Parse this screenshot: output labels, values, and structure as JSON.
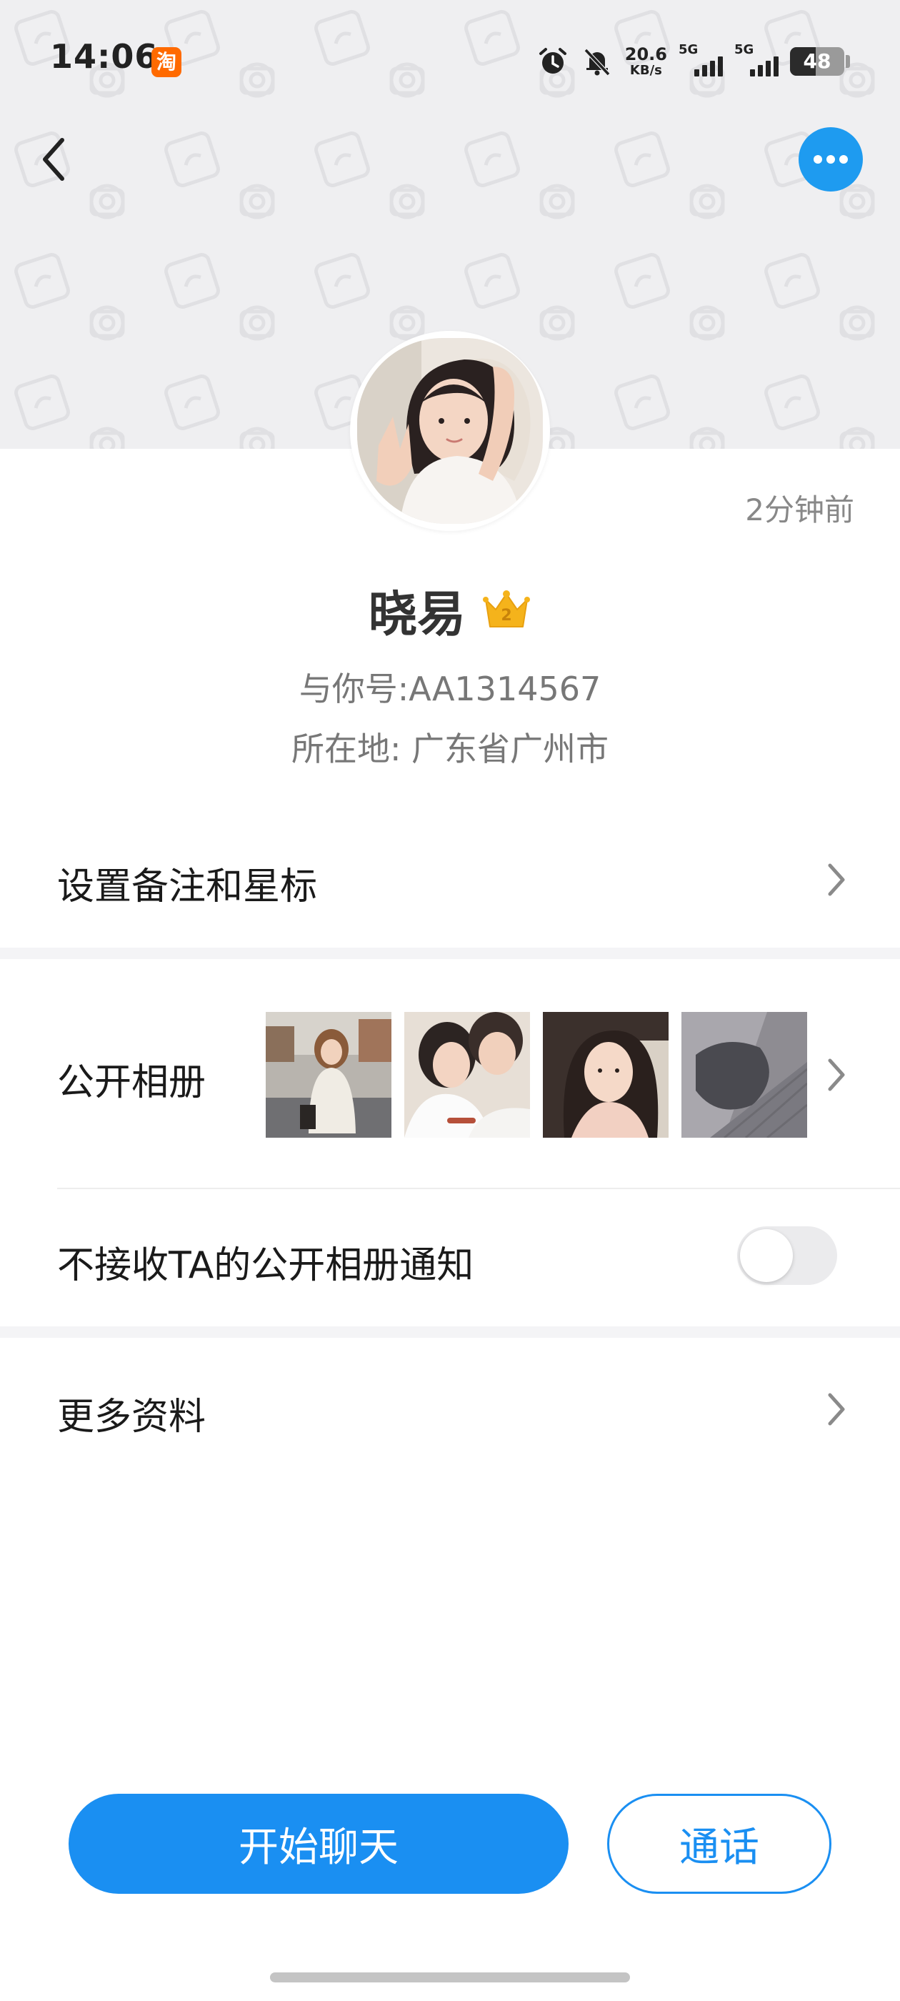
{
  "status_bar": {
    "time": "14:06",
    "app_badge": "淘",
    "net_speed_value": "20.6",
    "net_speed_unit": "KB/s",
    "sim1_label": "5G",
    "sim2_label": "5G",
    "battery_level": "48"
  },
  "nav": {
    "back_icon": "chevron-left-icon",
    "more_icon": "ellipsis-icon"
  },
  "profile": {
    "last_seen": "2分钟前",
    "name": "晓易",
    "vip_level": "2",
    "account_id": "与你号:AA1314567",
    "location": "所在地: 广东省广州市"
  },
  "rows": {
    "remark": "设置备注和星标",
    "album": "公开相册",
    "album_notify": "不接收TA的公开相册通知",
    "more_info": "更多资料"
  },
  "album_notify_toggle_on": false,
  "actions": {
    "chat": "开始聊天",
    "call": "通话"
  },
  "colors": {
    "accent": "#1a8ff2",
    "header_bg": "#efeff1",
    "crown": "#f5b31b",
    "taobao": "#ff6a00"
  }
}
